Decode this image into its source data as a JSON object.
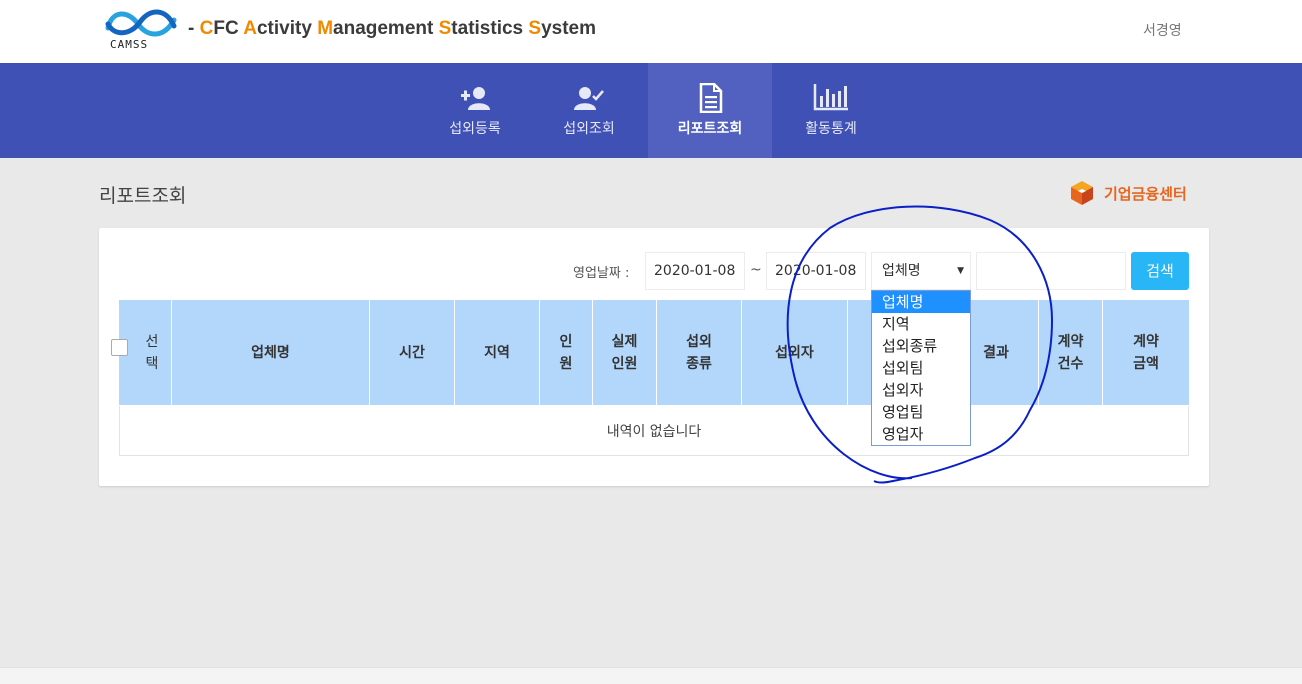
{
  "header": {
    "logo_text": "CAMSS",
    "title_parts": [
      {
        "text": "- ",
        "hl": false
      },
      {
        "text": "C",
        "hl": true
      },
      {
        "text": "FC ",
        "hl": false
      },
      {
        "text": "A",
        "hl": true
      },
      {
        "text": "ctivity ",
        "hl": false
      },
      {
        "text": "M",
        "hl": true
      },
      {
        "text": "anagement ",
        "hl": false
      },
      {
        "text": "S",
        "hl": true
      },
      {
        "text": "tatistics ",
        "hl": false
      },
      {
        "text": "S",
        "hl": true
      },
      {
        "text": "ystem",
        "hl": false
      }
    ],
    "user_name": "서경영"
  },
  "nav": {
    "items": [
      {
        "label": "섭외등록",
        "icon": "person-add-icon"
      },
      {
        "label": "섭외조회",
        "icon": "person-check-icon"
      },
      {
        "label": "리포트조회",
        "icon": "document-icon",
        "active": true
      },
      {
        "label": "활동통계",
        "icon": "bar-chart-icon"
      }
    ]
  },
  "page": {
    "title": "리포트조회",
    "brand": "기업금융센터"
  },
  "search": {
    "date_label": "영업날짜 :",
    "date_from": "2020-01-08",
    "tilde": "~",
    "date_to": "2020-01-08",
    "select_value": "업체명",
    "keyword": "",
    "button_label": "검색"
  },
  "dropdown": {
    "options": [
      "업체명",
      "지역",
      "섭외종류",
      "섭외팀",
      "섭외자",
      "영업팀",
      "영업자"
    ],
    "selected_index": 0
  },
  "table": {
    "columns": [
      {
        "label": "선\n택"
      },
      {
        "label": "업체명"
      },
      {
        "label": "시간"
      },
      {
        "label": "지역"
      },
      {
        "label": "인\n원"
      },
      {
        "label": "실제\n인원"
      },
      {
        "label": "섭외\n종류"
      },
      {
        "label": "섭외자"
      },
      {
        "label": ""
      },
      {
        "label": "결과"
      },
      {
        "label": "계약\n건수"
      },
      {
        "label": "계약\n금액"
      }
    ],
    "empty_message": "내역이 없습니다"
  },
  "colors": {
    "nav_bg": "#3f51b5",
    "nav_active": "#5261bf",
    "accent_orange": "#f08a00",
    "header_row": "#b3d7fb",
    "search_button": "#29b6f6",
    "scribble": "#0a1fc8"
  }
}
